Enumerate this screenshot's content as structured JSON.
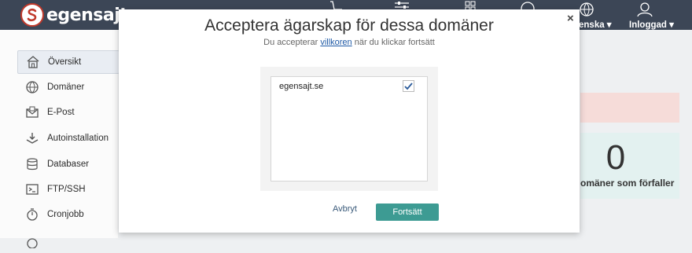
{
  "header": {
    "logo_text": "egensajt",
    "language_label": "enska ▾",
    "user_label": "Inloggad ▾"
  },
  "sidebar": {
    "items": [
      {
        "label": "Översikt",
        "icon": "home-icon",
        "active": true
      },
      {
        "label": "Domäner",
        "icon": "globe-icon"
      },
      {
        "label": "E-Post",
        "icon": "mail-icon"
      },
      {
        "label": "Autoinstallation",
        "icon": "install-icon"
      },
      {
        "label": "Databaser",
        "icon": "database-icon"
      },
      {
        "label": "FTP/SSH",
        "icon": "terminal-icon"
      },
      {
        "label": "Cronjobb",
        "icon": "stopwatch-icon"
      }
    ]
  },
  "background": {
    "count": "0",
    "count_label": "omäner som förfaller"
  },
  "modal": {
    "title": "Acceptera ägarskap för dessa domäner",
    "subtitle_before": "Du accepterar ",
    "subtitle_link": "villkoren",
    "subtitle_after": " när du klickar fortsätt",
    "close_symbol": "×",
    "domains": [
      {
        "name": "egensajt.se",
        "checked": true
      }
    ],
    "cancel_label": "Avbryt",
    "continue_label": "Fortsätt"
  },
  "colors": {
    "topbar": "#3c4656",
    "accent": "#3d9b93",
    "link": "#1f5aa6"
  }
}
